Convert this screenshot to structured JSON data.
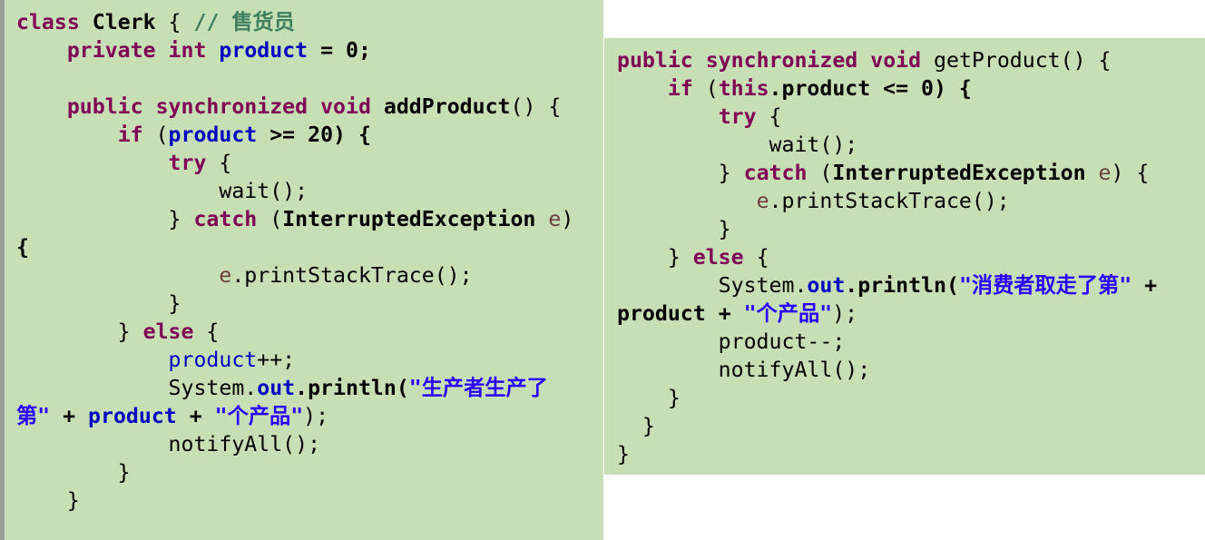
{
  "left_lines": [
    [
      {
        "t": "class",
        "c": "kw"
      },
      {
        "t": " "
      },
      {
        "t": "Clerk",
        "c": "b"
      },
      {
        "t": " { "
      },
      {
        "t": "// 售货员",
        "c": "cm"
      }
    ],
    [
      {
        "t": "    "
      },
      {
        "t": "private",
        "c": "kw"
      },
      {
        "t": " "
      },
      {
        "t": "int",
        "c": "kw"
      },
      {
        "t": " "
      },
      {
        "t": "product",
        "c": "bfld"
      },
      {
        "t": " = 0;",
        "c": "b"
      }
    ],
    [],
    [
      {
        "t": "    "
      },
      {
        "t": "public",
        "c": "kw"
      },
      {
        "t": " "
      },
      {
        "t": "synchronized",
        "c": "kw"
      },
      {
        "t": " "
      },
      {
        "t": "void",
        "c": "kw"
      },
      {
        "t": " "
      },
      {
        "t": "addProduct",
        "c": "b"
      },
      {
        "t": "() {"
      }
    ],
    [
      {
        "t": "        "
      },
      {
        "t": "if",
        "c": "kw"
      },
      {
        "t": " ("
      },
      {
        "t": "product",
        "c": "bfld"
      },
      {
        "t": " >= 20) {",
        "c": "b"
      }
    ],
    [
      {
        "t": "            "
      },
      {
        "t": "try",
        "c": "kw"
      },
      {
        "t": " {"
      }
    ],
    [
      {
        "t": "                wait();"
      }
    ],
    [
      {
        "t": "            } "
      },
      {
        "t": "catch",
        "c": "kw"
      },
      {
        "t": " ("
      },
      {
        "t": "InterruptedException",
        "c": "b"
      },
      {
        "t": " "
      },
      {
        "t": "e",
        "c": "var"
      },
      {
        "t": ")"
      }
    ],
    [
      {
        "t": "{",
        "c": "b"
      }
    ],
    [
      {
        "t": "                "
      },
      {
        "t": "e",
        "c": "var"
      },
      {
        "t": ".printStackTrace();"
      }
    ],
    [
      {
        "t": "            }"
      }
    ],
    [
      {
        "t": "        } "
      },
      {
        "t": "else",
        "c": "kw"
      },
      {
        "t": " {"
      }
    ],
    [
      {
        "t": "            "
      },
      {
        "t": "product",
        "c": "fld"
      },
      {
        "t": "++;"
      }
    ],
    [
      {
        "t": "            System."
      },
      {
        "t": "out",
        "c": "bfld"
      },
      {
        "t": ".println(",
        "c": "b"
      },
      {
        "t": "\"生产者生产了",
        "c": "str"
      }
    ],
    [
      {
        "t": "第\"",
        "c": "str"
      },
      {
        "t": " + ",
        "c": "b"
      },
      {
        "t": "product",
        "c": "bfld"
      },
      {
        "t": " + ",
        "c": "b"
      },
      {
        "t": "\"个产品\"",
        "c": "str"
      },
      {
        "t": ");"
      }
    ],
    [
      {
        "t": "            notifyAll();"
      }
    ],
    [
      {
        "t": "        }"
      }
    ],
    [
      {
        "t": "    }"
      }
    ]
  ],
  "right_lines": [
    [
      {
        "t": "public",
        "c": "kw"
      },
      {
        "t": " "
      },
      {
        "t": "synchronized",
        "c": "kw"
      },
      {
        "t": " "
      },
      {
        "t": "void",
        "c": "kw"
      },
      {
        "t": " getProduct() {"
      }
    ],
    [
      {
        "t": "    "
      },
      {
        "t": "if",
        "c": "kw"
      },
      {
        "t": " ("
      },
      {
        "t": "this",
        "c": "kw"
      },
      {
        "t": ".product <= 0) {",
        "c": "b"
      }
    ],
    [
      {
        "t": "        "
      },
      {
        "t": "try",
        "c": "kw"
      },
      {
        "t": " {"
      }
    ],
    [
      {
        "t": "            wait();"
      }
    ],
    [
      {
        "t": "        } "
      },
      {
        "t": "catch",
        "c": "kw"
      },
      {
        "t": " ("
      },
      {
        "t": "InterruptedException",
        "c": "b"
      },
      {
        "t": " "
      },
      {
        "t": "e",
        "c": "var"
      },
      {
        "t": ") {"
      }
    ],
    [
      {
        "t": "           "
      },
      {
        "t": "e",
        "c": "var"
      },
      {
        "t": ".printStackTrace();"
      }
    ],
    [
      {
        "t": "        }"
      }
    ],
    [
      {
        "t": "    } "
      },
      {
        "t": "else",
        "c": "kw"
      },
      {
        "t": " {"
      }
    ],
    [
      {
        "t": "        System."
      },
      {
        "t": "out",
        "c": "bfld"
      },
      {
        "t": ".println(",
        "c": "b"
      },
      {
        "t": "\"消费者取走了第\"",
        "c": "str"
      },
      {
        "t": " +",
        "c": "b"
      }
    ],
    [
      {
        "t": "product",
        "c": "b"
      },
      {
        "t": " + ",
        "c": "b"
      },
      {
        "t": "\"个产品\"",
        "c": "str"
      },
      {
        "t": ");"
      }
    ],
    [
      {
        "t": "        product--;"
      }
    ],
    [
      {
        "t": "        notifyAll();"
      }
    ],
    [
      {
        "t": "    }"
      }
    ],
    [
      {
        "t": "  }"
      }
    ],
    [
      {
        "t": "}"
      }
    ]
  ]
}
